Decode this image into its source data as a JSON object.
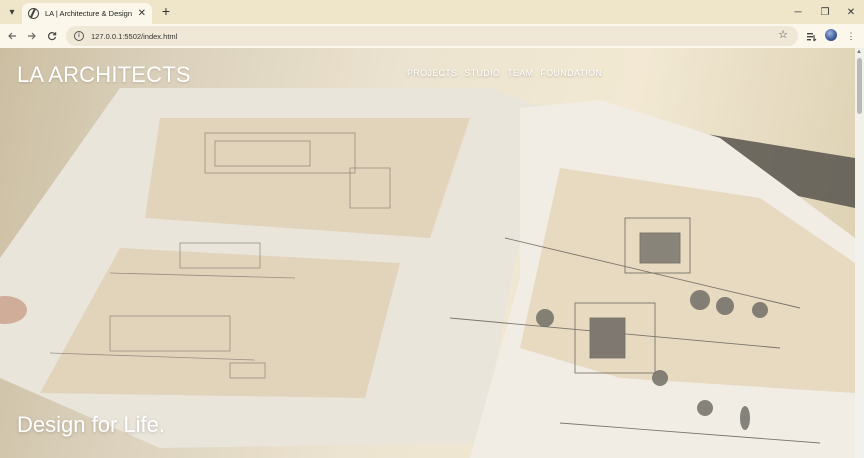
{
  "browser": {
    "tab_title": "LA | Architecture & Design Stud",
    "new_tab_symbol": "+",
    "url": "127.0.0.1:5502/index.html",
    "window_controls": {
      "minimize": "─",
      "maximize": "❐",
      "close": "✕"
    }
  },
  "site": {
    "brand": "LA ARCHITECTS",
    "nav": [
      "PROJECTS",
      "STUDIO",
      "TEAM",
      "FOUNDATION"
    ],
    "tagline": "Design for Life."
  },
  "icons": {
    "back": "back-arrow-icon",
    "forward": "forward-arrow-icon",
    "reload": "reload-icon",
    "bookmark": "star-icon",
    "extensions": "extensions-icon",
    "menu": "kebab-menu-icon"
  },
  "colors": {
    "tab_strip": "#efe5c9",
    "toolbar": "#fbf7ea",
    "nav_text": "#ffffff"
  }
}
